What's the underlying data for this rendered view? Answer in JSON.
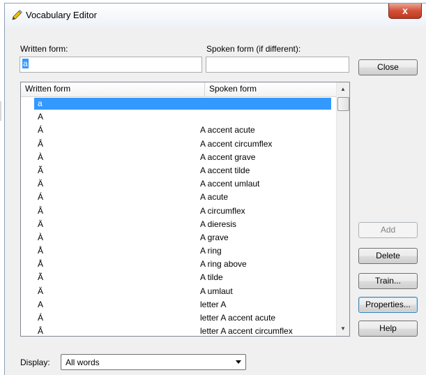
{
  "window": {
    "title": "Vocabulary Editor",
    "close_glyph": "x"
  },
  "labels": {
    "written_form": "Written form:",
    "spoken_form": "Spoken form (if different):",
    "display": "Display:"
  },
  "inputs": {
    "written_value": "a",
    "spoken_value": ""
  },
  "list": {
    "columns": [
      "Written form",
      "Spoken form"
    ],
    "selected_index": 0,
    "rows": [
      {
        "written": "a",
        "spoken": ""
      },
      {
        "written": "A",
        "spoken": ""
      },
      {
        "written": "Á",
        "spoken": "A accent acute"
      },
      {
        "written": "Â",
        "spoken": "A accent circumflex"
      },
      {
        "written": "À",
        "spoken": "A accent grave"
      },
      {
        "written": "Ã",
        "spoken": "A accent tilde"
      },
      {
        "written": "Ä",
        "spoken": "A accent umlaut"
      },
      {
        "written": "Á",
        "spoken": "A acute"
      },
      {
        "written": "Â",
        "spoken": "A circumflex"
      },
      {
        "written": "Ä",
        "spoken": "A dieresis"
      },
      {
        "written": "À",
        "spoken": "A grave"
      },
      {
        "written": "Å",
        "spoken": "A ring"
      },
      {
        "written": "Å",
        "spoken": "A ring above"
      },
      {
        "written": "Ã",
        "spoken": "A tilde"
      },
      {
        "written": "Ä",
        "spoken": "A umlaut"
      },
      {
        "written": "A",
        "spoken": "letter A"
      },
      {
        "written": "Á",
        "spoken": "letter A accent acute"
      },
      {
        "written": "Â",
        "spoken": "letter A accent circumflex"
      }
    ]
  },
  "buttons": {
    "close": "Close",
    "add": "Add",
    "delete": "Delete",
    "train": "Train...",
    "properties": "Properties...",
    "help": "Help"
  },
  "display_select": {
    "value": "All words"
  },
  "colors": {
    "selection": "#3399ff",
    "close_button": "#d2513a"
  },
  "icons": {
    "title": "pencil-icon"
  }
}
